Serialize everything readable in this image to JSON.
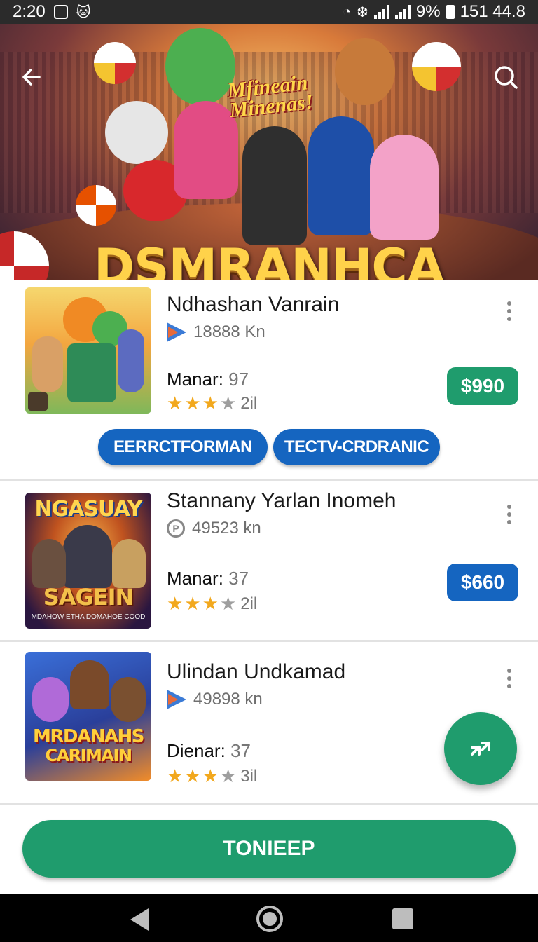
{
  "status_bar": {
    "time": "2:20",
    "battery_percent": "9%",
    "right_text": "151 44.8"
  },
  "hero": {
    "subtitle_line1": "Mfineain",
    "subtitle_line2": "Minenas!",
    "title": "DSMRANHCA",
    "back_icon": "arrow-left-icon",
    "search_icon": "search-icon"
  },
  "items": [
    {
      "title": "Ndhashan Vanrain",
      "size": "18888 Kn",
      "meta_icon": "play-store-icon",
      "rating_label": "Manar:",
      "rating_value": "97",
      "stars": 3,
      "review_count": "2il",
      "price": "$990",
      "price_color": "#1f9c6d",
      "chips": [
        "EERRCTFORMAN",
        "TECTV-CRDRANIC"
      ]
    },
    {
      "title": "Stannany Yarlan Inomeh",
      "size": "49523 kn",
      "meta_icon": "circle-p-icon",
      "rating_label": "Manar:",
      "rating_value": "37",
      "stars": 3,
      "review_count": "2il",
      "price": "$660",
      "price_color": "#1565c0",
      "thumb_top_text": "NGASUAY",
      "thumb_mid_text": "SAGEIN",
      "thumb_bottom_text": "MDAHOW ETHA DOMAHOE COOD"
    },
    {
      "title": "Ulindan Undkamad",
      "size": "49898 kn",
      "meta_icon": "play-store-icon",
      "rating_label": "Dienar:",
      "rating_value": "37",
      "stars": 3,
      "review_count": "3il",
      "thumb_text_1": "MRDANAHS",
      "thumb_text_2": "CARIMAIN"
    }
  ],
  "fab": {
    "icon": "swap-arrows-icon"
  },
  "bottom_button": {
    "label": "TONIEEP"
  },
  "nav": {
    "back": "nav-back-icon",
    "home": "nav-home-icon",
    "recents": "nav-recents-icon"
  }
}
